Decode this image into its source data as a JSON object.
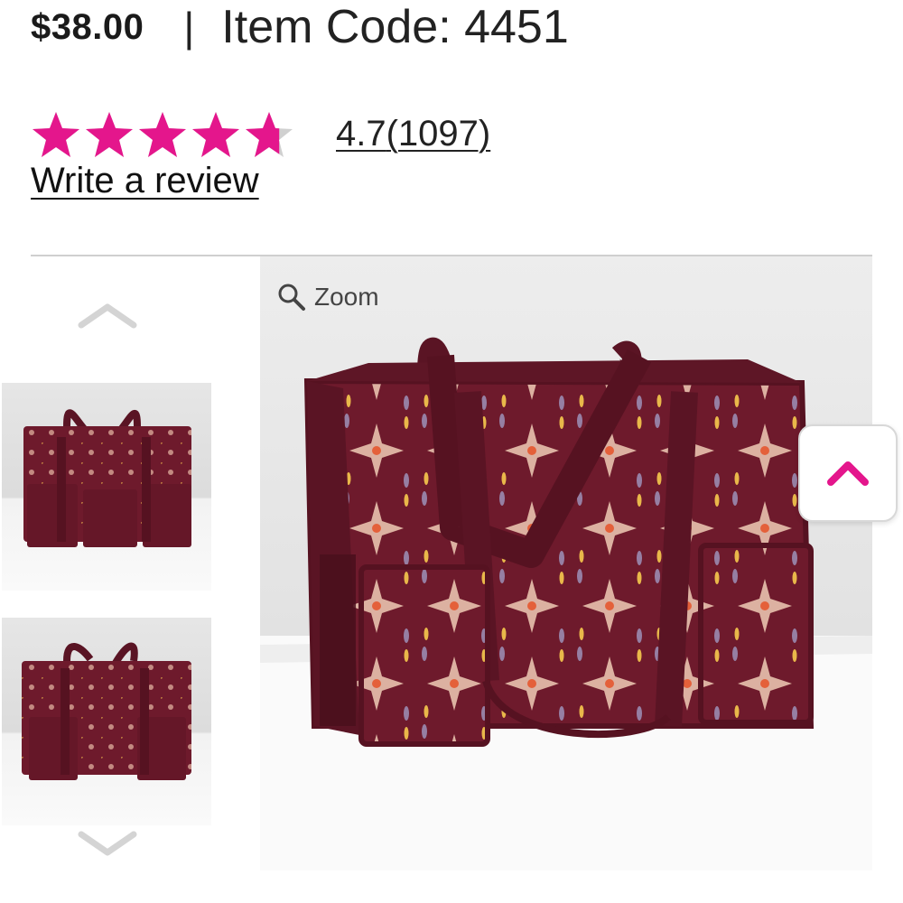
{
  "product": {
    "price": "$38.00",
    "separator": "|",
    "item_code": "Item Code: 4451"
  },
  "rating": {
    "value": 4.7,
    "max": 5,
    "label": "4.7",
    "count_label": "(1097)",
    "write_review": "Write a review"
  },
  "gallery": {
    "zoom_label": "Zoom",
    "thumbnail_count": 2,
    "selected_thumbnail": 1
  },
  "icons": {
    "star": "star-icon",
    "zoom": "magnifier-icon",
    "up": "chevron-up-icon",
    "down": "chevron-down-icon",
    "back_to_top": "chevron-up-icon"
  },
  "colors": {
    "accent": "#e4168c",
    "star_empty": "#d0d0d0",
    "bag": "#6e1a2c",
    "bag_dark": "#561221"
  }
}
